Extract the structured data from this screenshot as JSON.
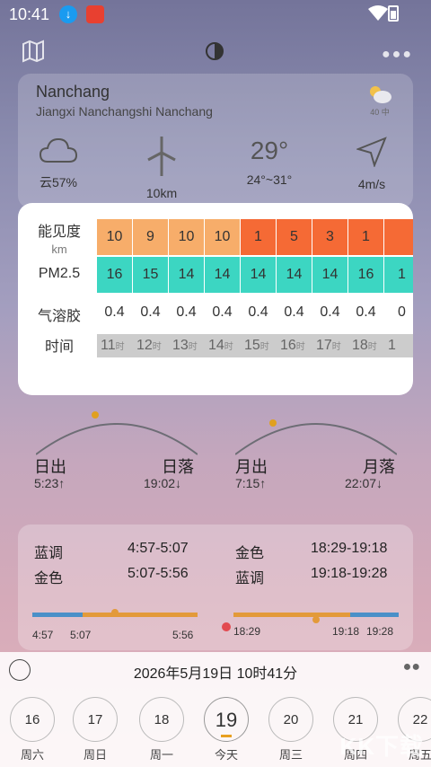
{
  "status_bar": {
    "time": "10:41"
  },
  "location": {
    "city": "Nanchang",
    "full": "Jiangxi Nanchangshi Nanchang",
    "aqi_badge": "40 中"
  },
  "weather": {
    "cloud": "云57%",
    "visibility": "10km",
    "temperature": "29°",
    "temp_range": "24°~31°",
    "wind": "4m/s"
  },
  "table": {
    "visibility_label": "能见度",
    "visibility_unit": "km",
    "pm25_label": "PM2.5",
    "aerosol_label": "气溶胶",
    "time_label": "时间",
    "visibility": [
      "10",
      "9",
      "10",
      "10",
      "1",
      "5",
      "3",
      "1",
      ""
    ],
    "visibility_colors": [
      "#f7ad6a",
      "#f7ad6a",
      "#f7ad6a",
      "#f7ad6a",
      "#f56a35",
      "#f56a35",
      "#f56a35",
      "#f56a35",
      "#f56a35"
    ],
    "pm25": [
      "16",
      "15",
      "14",
      "14",
      "14",
      "14",
      "14",
      "16",
      "1"
    ],
    "aerosol": [
      "0.4",
      "0.4",
      "0.4",
      "0.4",
      "0.4",
      "0.4",
      "0.4",
      "0.4",
      "0"
    ],
    "hours": [
      "11",
      "12",
      "13",
      "14",
      "15",
      "16",
      "17",
      "18",
      "1"
    ],
    "hour_suffix": "时"
  },
  "sun": {
    "sunrise_label": "日出",
    "sunrise_time": "5:23↑",
    "sunset_label": "日落",
    "sunset_time": "19:02↓",
    "moonrise_label": "月出",
    "moonrise_time": "7:15↑",
    "moonset_label": "月落",
    "moonset_time": "22:07↓"
  },
  "twilight": {
    "left": [
      {
        "label": "蓝调",
        "time": "4:57-5:07"
      },
      {
        "label": "金色",
        "time": "5:07-5:56"
      }
    ],
    "right": [
      {
        "label": "金色",
        "time": "18:29-19:18"
      },
      {
        "label": "蓝调",
        "time": "19:18-19:28"
      }
    ],
    "ticks_left": [
      "4:57",
      "5:07",
      "5:56"
    ],
    "ticks_right": [
      "18:29",
      "19:18",
      "19:28"
    ],
    "blue": "#4a90c8",
    "gold": "#e39a3a"
  },
  "date": {
    "text": "2026年5月19日 10时41分"
  },
  "week": [
    {
      "num": "16",
      "wd": "周六"
    },
    {
      "num": "17",
      "wd": "周日"
    },
    {
      "num": "18",
      "wd": "周一"
    },
    {
      "num": "19",
      "wd": "今天",
      "today": true
    },
    {
      "num": "20",
      "wd": "周三"
    },
    {
      "num": "21",
      "wd": "周四"
    },
    {
      "num": "22",
      "wd": "周五"
    }
  ],
  "watermark": "KK下载"
}
